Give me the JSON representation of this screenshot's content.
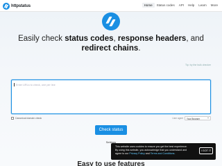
{
  "brand": {
    "name": "httpstatus"
  },
  "nav": {
    "items": [
      "Home",
      "Status codes",
      "API",
      "Help",
      "Learn",
      "More"
    ]
  },
  "hero": {
    "tagline": {
      "t1": "Easily check ",
      "b1": "status codes",
      "t2": ", ",
      "b2": "response headers",
      "t3": ", and ",
      "b3": "redirect chains",
      "t4": "."
    }
  },
  "form": {
    "hint_link": "Tip: try the bulk checker",
    "url_placeholder": "Enter URLs to check, one per line",
    "canonical_label": "Canonical domain check",
    "ua_label": "User agent",
    "ua_value": "Your Browser",
    "submit_label": "Check status",
    "settings_label": "Settings"
  },
  "features": {
    "title": "Easy to use features"
  },
  "cookie": {
    "line1": "This website uses cookies to ensure you get the best experience.",
    "line2": "By using this website, you acknowledge that you understand and",
    "agree_prefix": "agree to our ",
    "privacy": "Privacy Policy",
    "and": " and ",
    "terms": "Terms and Conditions",
    "end": ".",
    "button": "I GOT IT"
  },
  "colors": {
    "accent": "#1a8fe3",
    "cookie_bg": "#111111"
  }
}
